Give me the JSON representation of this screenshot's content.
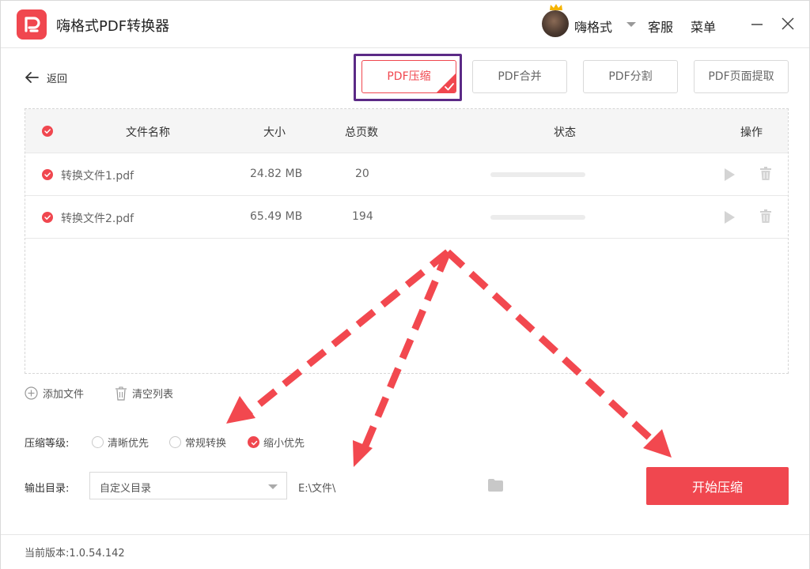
{
  "app": {
    "title": "嗨格式PDF转换器",
    "user_name": "嗨格式",
    "service_label": "客服",
    "menu_label": "菜单"
  },
  "nav": {
    "back_label": "返回"
  },
  "tabs": [
    {
      "label": "PDF压缩",
      "active": true
    },
    {
      "label": "PDF合并",
      "active": false
    },
    {
      "label": "PDF分割",
      "active": false
    },
    {
      "label": "PDF页面提取",
      "active": false
    }
  ],
  "table": {
    "headers": {
      "name": "文件名称",
      "size": "大小",
      "pages": "总页数",
      "status": "状态",
      "actions": "操作"
    },
    "rows": [
      {
        "name": "转换文件1.pdf",
        "size": "24.82 MB",
        "pages": "20",
        "progress": 0
      },
      {
        "name": "转换文件2.pdf",
        "size": "65.49 MB",
        "pages": "194",
        "progress": 0
      }
    ]
  },
  "tools": {
    "add_file": "添加文件",
    "clear_list": "清空列表"
  },
  "compression": {
    "label": "压缩等级:",
    "options": [
      {
        "label": "清晰优先",
        "selected": false
      },
      {
        "label": "常规转换",
        "selected": false
      },
      {
        "label": "缩小优先",
        "selected": true
      }
    ]
  },
  "output": {
    "label": "输出目录:",
    "select_value": "自定义目录",
    "path": "E:\\文件\\"
  },
  "start_button": "开始压缩",
  "footer": {
    "version": "当前版本:1.0.54.142"
  },
  "colors": {
    "accent": "#f0474f",
    "highlight_box": "#5b2a86"
  }
}
